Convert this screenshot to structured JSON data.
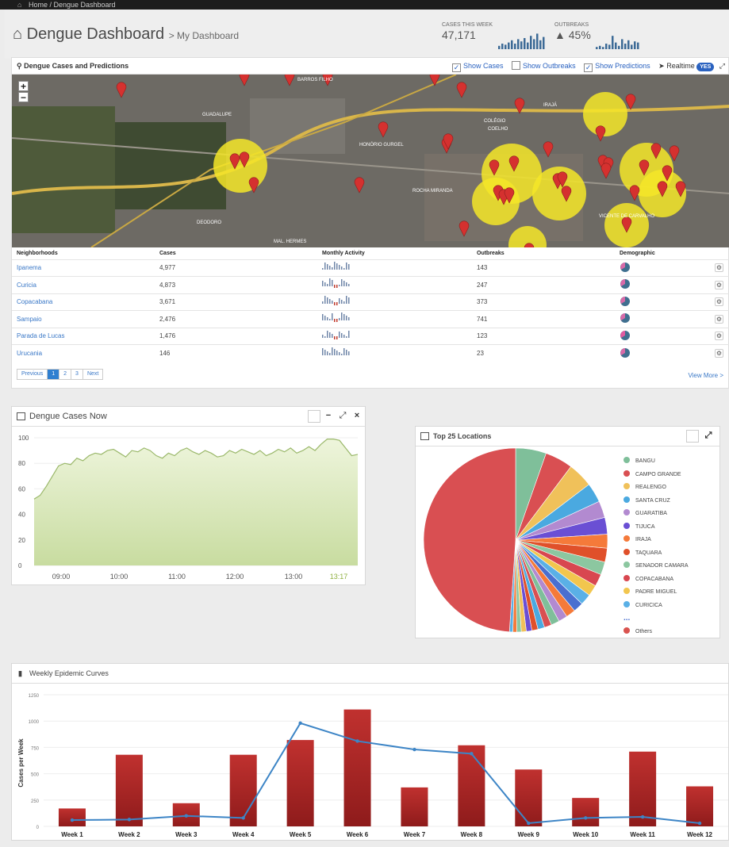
{
  "breadcrumb": {
    "home": "Home",
    "current": "Dengue Dashboard"
  },
  "header": {
    "title": "Dengue Dashboard",
    "subtitle": "> My Dashboard"
  },
  "stats": [
    {
      "label": "CASES THIS WEEK",
      "value": "47,171"
    },
    {
      "label": "OUTBREAKS",
      "value": "45%"
    }
  ],
  "map_panel": {
    "title": "Dengue Cases and Predictions",
    "show_cases": "Show Cases",
    "show_outbreaks": "Show Outbreaks",
    "show_predictions": "Show Predictions",
    "realtime": "Realtime",
    "toggle": "YES",
    "zoom_in": "+",
    "zoom_out": "−",
    "labels": [
      "BARROS FILHO",
      "GUADALUPE",
      "HONÓRIO GURGEL",
      "ROCHA MIRANDA",
      "IRAJÁ",
      "COELHO",
      "DEODORO",
      "MAL. HERMES",
      "COLÉGIO",
      "VICENTE DE CARVALHO"
    ]
  },
  "table": {
    "headers": [
      "Neighborhoods",
      "Cases",
      "Monthly Activity",
      "Outbreaks",
      "Demographic"
    ],
    "rows": [
      {
        "name": "Ipanema",
        "cases": "4,977",
        "outbreaks": "143"
      },
      {
        "name": "Curicia",
        "cases": "4,873",
        "outbreaks": "247"
      },
      {
        "name": "Copacabana",
        "cases": "3,671",
        "outbreaks": "373"
      },
      {
        "name": "Sampaio",
        "cases": "2,476",
        "outbreaks": "741"
      },
      {
        "name": "Parada de Lucas",
        "cases": "1,476",
        "outbreaks": "123"
      },
      {
        "name": "Urucania",
        "cases": "146",
        "outbreaks": "23"
      }
    ]
  },
  "pager": {
    "prev": "Previous",
    "pages": [
      "1",
      "2",
      "3"
    ],
    "next": "Next",
    "view_more": "View More >"
  },
  "widgets": {
    "cases_now": "Dengue Cases Now",
    "top25": "Top 25 Locations",
    "weekly": "Weekly Epidemic Curves"
  },
  "legend": [
    {
      "name": "BANGU",
      "color": "#7fbf9a"
    },
    {
      "name": "CAMPO GRANDE",
      "color": "#d94f52"
    },
    {
      "name": "REALENGO",
      "color": "#f0c15a"
    },
    {
      "name": "SANTA CRUZ",
      "color": "#4aa9e0"
    },
    {
      "name": "GUARATIBA",
      "color": "#b28ad0"
    },
    {
      "name": "TIJUCA",
      "color": "#6a4fd4"
    },
    {
      "name": "IRAJA",
      "color": "#f57a3a"
    },
    {
      "name": "TAQUARA",
      "color": "#e0502a"
    },
    {
      "name": "SENADOR CAMARA",
      "color": "#8cc7a0"
    },
    {
      "name": "COPACABANA",
      "color": "#d84750"
    },
    {
      "name": "PADRE MIGUEL",
      "color": "#f2c64e"
    },
    {
      "name": "CURICICA",
      "color": "#5ab0e6"
    },
    {
      "name": "...",
      "color": "#4a6fd0"
    },
    {
      "name": "Others",
      "color": "#d9534f"
    }
  ],
  "chart_data": [
    {
      "type": "area",
      "title": "Dengue Cases Now",
      "x_ticks": [
        "09:00",
        "10:00",
        "11:00",
        "12:00",
        "13:00",
        "13:17"
      ],
      "ylim": [
        0,
        100
      ],
      "y_ticks": [
        0,
        20,
        40,
        60,
        80,
        100
      ],
      "values": [
        52,
        55,
        62,
        70,
        78,
        80,
        79,
        84,
        82,
        86,
        88,
        87,
        90,
        91,
        88,
        85,
        90,
        89,
        92,
        90,
        86,
        84,
        88,
        86,
        90,
        92,
        89,
        87,
        90,
        88,
        85,
        86,
        90,
        88,
        91,
        89,
        87,
        90,
        86,
        88,
        91,
        89,
        92,
        88,
        90,
        93,
        90,
        95,
        99,
        99,
        98,
        92,
        86,
        87
      ]
    },
    {
      "type": "pie",
      "title": "Top 25 Locations",
      "values": [
        50,
        5.5,
        5,
        4.5,
        3.5,
        3,
        3,
        2.5,
        2.5,
        2.3,
        2.2,
        2,
        2,
        1.8,
        1.7,
        1.6,
        1.5,
        1.3,
        1.2,
        1.1,
        1,
        0.9,
        0.8,
        0.7,
        0.6
      ]
    },
    {
      "type": "bar",
      "title": "Weekly Epidemic Curves",
      "ylabel": "Cases per Week",
      "ylim": [
        0,
        1250
      ],
      "y_ticks": [
        0,
        250,
        500,
        750,
        1000,
        1250
      ],
      "categories": [
        "Week 1",
        "Week 2",
        "Week 3",
        "Week 4",
        "Week 5",
        "Week 6",
        "Week 7",
        "Week 8",
        "Week 9",
        "Week 10",
        "Week 11",
        "Week 12"
      ],
      "series": [
        {
          "values": [
            170,
            680,
            220,
            680,
            820,
            1110,
            370,
            770,
            540,
            270,
            710,
            380
          ]
        },
        {
          "values": [
            60,
            65,
            100,
            80,
            980,
            810,
            730,
            690,
            30,
            80,
            90,
            30
          ]
        }
      ]
    }
  ]
}
